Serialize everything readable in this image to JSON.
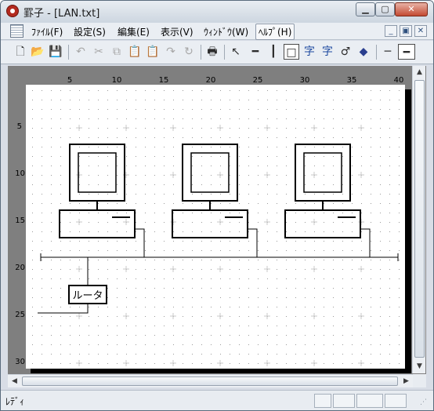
{
  "window": {
    "title": "罫子 - [LAN.txt]",
    "title_icon": "app-logo-icon",
    "controls": {
      "minimize": "▁",
      "maximize": "▢",
      "close": "✕"
    }
  },
  "menu": {
    "items": [
      "ﾌｧｲﾙ(F)",
      "設定(S)",
      "編集(E)",
      "表示(V)",
      "ｳｨﾝﾄﾞｳ(W)",
      "ﾍﾙﾌﾟ(H)"
    ],
    "active_index": 5,
    "mdi_controls": {
      "minimize": "_",
      "restore": "▣",
      "close": "✕"
    }
  },
  "toolbar": {
    "buttons": [
      {
        "name": "new-file-icon",
        "glyph": "🗋",
        "enabled": true
      },
      {
        "name": "open-folder-icon",
        "glyph": "📂",
        "enabled": true
      },
      {
        "name": "save-icon",
        "glyph": "💾",
        "enabled": true
      },
      {
        "name": "undo-icon",
        "glyph": "↶",
        "enabled": false
      },
      {
        "name": "cut-icon",
        "glyph": "✂",
        "enabled": false
      },
      {
        "name": "copy-icon",
        "glyph": "⧉",
        "enabled": false
      },
      {
        "name": "paste-icon",
        "glyph": "📋",
        "enabled": true
      },
      {
        "name": "paste-special-icon",
        "glyph": "📋",
        "enabled": true
      },
      {
        "name": "redo-icon",
        "glyph": "↷",
        "enabled": false
      },
      {
        "name": "repeat-icon",
        "glyph": "↻",
        "enabled": false
      },
      {
        "name": "print-icon",
        "glyph": "🖶",
        "enabled": true
      },
      {
        "name": "select-arrow-icon",
        "glyph": "↖",
        "enabled": true
      },
      {
        "name": "horizontal-line-icon",
        "glyph": "━",
        "enabled": true
      },
      {
        "name": "vertical-line-icon",
        "glyph": "┃",
        "enabled": true
      },
      {
        "name": "rectangle-icon",
        "glyph": "□",
        "enabled": true,
        "pressed": true
      },
      {
        "name": "text-tool-icon",
        "glyph": "字",
        "enabled": true
      },
      {
        "name": "text-tool-2-icon",
        "glyph": "字",
        "enabled": true
      },
      {
        "name": "connector-icon",
        "glyph": "♂",
        "enabled": true
      },
      {
        "name": "eraser-icon",
        "glyph": "◆",
        "enabled": true
      },
      {
        "name": "thin-line-icon",
        "glyph": "─",
        "enabled": true
      },
      {
        "name": "thick-line-icon",
        "glyph": "━",
        "enabled": true,
        "pressed": true
      }
    ]
  },
  "ruler": {
    "columns": [
      "5",
      "10",
      "15",
      "20",
      "25",
      "30",
      "35",
      "40"
    ],
    "rows": [
      "5",
      "10",
      "15",
      "20",
      "25",
      "30"
    ]
  },
  "diagram": {
    "computers": [
      "pc-1",
      "pc-2",
      "pc-3"
    ],
    "router_label": "ルータ"
  },
  "status": {
    "text": "ﾚﾃﾞｨ"
  },
  "colors": {
    "titlebar": "#dde3ea",
    "workspace": "#7f7f7f",
    "paper": "#ffffff",
    "shadow": "#000000",
    "grid_dot": "#9a9a9a",
    "grid_plus": "#c8c8c8",
    "drawing_line": "#000000",
    "selection_button": "#1f4aa0"
  }
}
